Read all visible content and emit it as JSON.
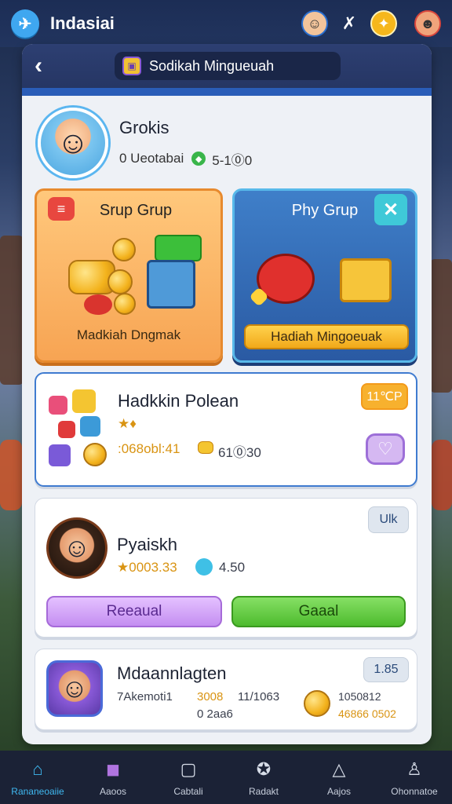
{
  "topbar": {
    "title": "Indasiai",
    "icons": [
      "app-logo-icon",
      "player-avatar-icon",
      "crossed-tools-icon",
      "gold-coin-icon",
      "profile-face-icon"
    ]
  },
  "header": {
    "back_icon": "‹",
    "pill_label": "Sodikah Mingueuah"
  },
  "profile": {
    "name": "Grokis",
    "stat_text": "0 Ueotabai",
    "stat_value": "5-1⓪0"
  },
  "groups": [
    {
      "title": "Srup Grup",
      "label": "Madkiah Dngmak",
      "badge": "≡"
    },
    {
      "title": "Phy Grup",
      "label": "Hadiah Mingoeuak",
      "close": "✕"
    }
  ],
  "list": [
    {
      "title": "Hadkkin Polean",
      "stars": "★♦",
      "amount_gold": ":068obl:41",
      "amount_plain": "61⓪30",
      "tag": "11℃P"
    },
    {
      "title": "Pyaiskh",
      "amount_gold": "★0003.33",
      "amount_plain": "4.50",
      "tag": "Ulk",
      "btn_left": "Reeaual",
      "btn_right": "Gaaal"
    },
    {
      "title": "Mdaannlagten",
      "line1_left": "7Akemoti1",
      "line1_mid": "3008",
      "line1_mid2": "11/1063",
      "line2": "0 2aa6",
      "right_top": "1050812",
      "right_bottom": "46866 0502",
      "tag": "1.85"
    }
  ],
  "nav": [
    {
      "label": "Rananeoaiie",
      "icon": "home-icon",
      "active": true
    },
    {
      "label": "Aaoos",
      "icon": "cube-icon",
      "active": false
    },
    {
      "label": "Cabtali",
      "icon": "calendar-icon",
      "active": false
    },
    {
      "label": "Radakt",
      "icon": "badge-icon",
      "active": false
    },
    {
      "label": "Aajos",
      "icon": "warning-icon",
      "active": false
    },
    {
      "label": "Ohonnatoe",
      "icon": "user-icon",
      "active": false
    }
  ],
  "colors": {
    "accent_blue": "#3fb8f0",
    "orange_card": "#f7a453",
    "blue_card": "#2a5aa3",
    "purple_button": "#c48ef1",
    "green_button": "#4ebb2e"
  }
}
